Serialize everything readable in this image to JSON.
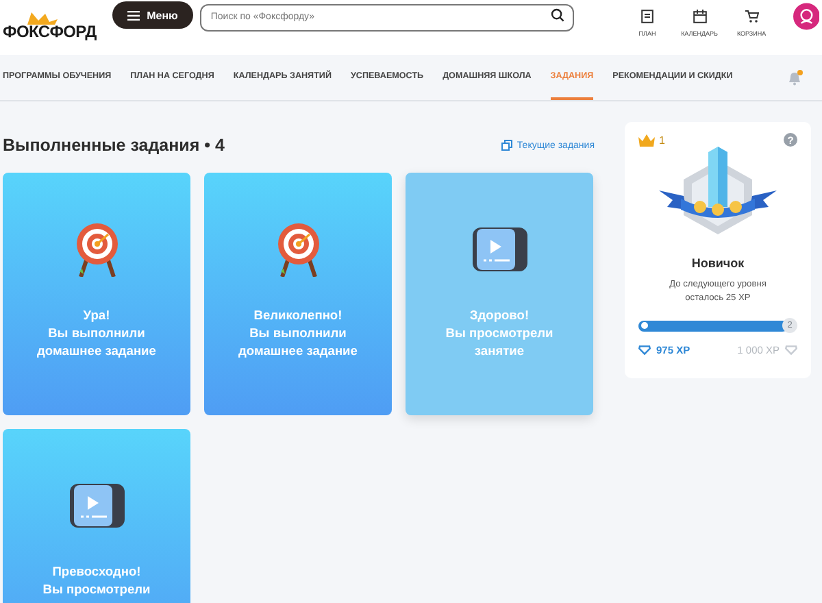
{
  "header": {
    "logo": "ФОКСФОРД",
    "menu_button": "Меню",
    "search": {
      "placeholder": "Поиск по «Фоксфорду»"
    },
    "actions": [
      {
        "kind": "plan",
        "label": "ПЛАН"
      },
      {
        "kind": "calendar",
        "label": "КАЛЕНДАРЬ"
      },
      {
        "kind": "cart",
        "label": "КОРЗИНА"
      }
    ]
  },
  "nav": {
    "tabs": [
      {
        "label": "ПРОГРАММЫ ОБУЧЕНИЯ",
        "selected": false
      },
      {
        "label": "ПЛАН НА СЕГОДНЯ",
        "selected": false
      },
      {
        "label": "КАЛЕНДАРЬ ЗАНЯТИЙ",
        "selected": false
      },
      {
        "label": "УСПЕВАЕМОСТЬ",
        "selected": false
      },
      {
        "label": "ДОМАШНЯЯ ШКОЛА",
        "selected": false
      },
      {
        "label": "ЗАДАНИЯ",
        "selected": true
      },
      {
        "label": "РЕКОМЕНДАЦИИ И СКИДКИ",
        "selected": false
      }
    ],
    "notification_unread": true
  },
  "tasks": {
    "title": "Выполненные задания • 4",
    "current_link": "Текущие задания",
    "cards": [
      {
        "kind": "homework",
        "lines": [
          "Ура!",
          "Вы выполнили",
          "домашнее задание"
        ]
      },
      {
        "kind": "homework",
        "lines": [
          "Великолепно!",
          "Вы выполнили",
          "домашнее задание"
        ]
      },
      {
        "kind": "lesson",
        "lines": [
          "Здорово!",
          "Вы просмотрели",
          "занятие"
        ]
      },
      {
        "kind": "homework-lesson",
        "lines": [
          "Превосходно!",
          "Вы просмотрели"
        ]
      }
    ]
  },
  "level_panel": {
    "crowns": "1",
    "help": "?",
    "rank": "Новичок",
    "hint": "До следующего уровня осталось 25 XP",
    "level": 0.975,
    "next_level": "2",
    "xp": "975 XP",
    "xp_goal": "1 000 XP"
  }
}
